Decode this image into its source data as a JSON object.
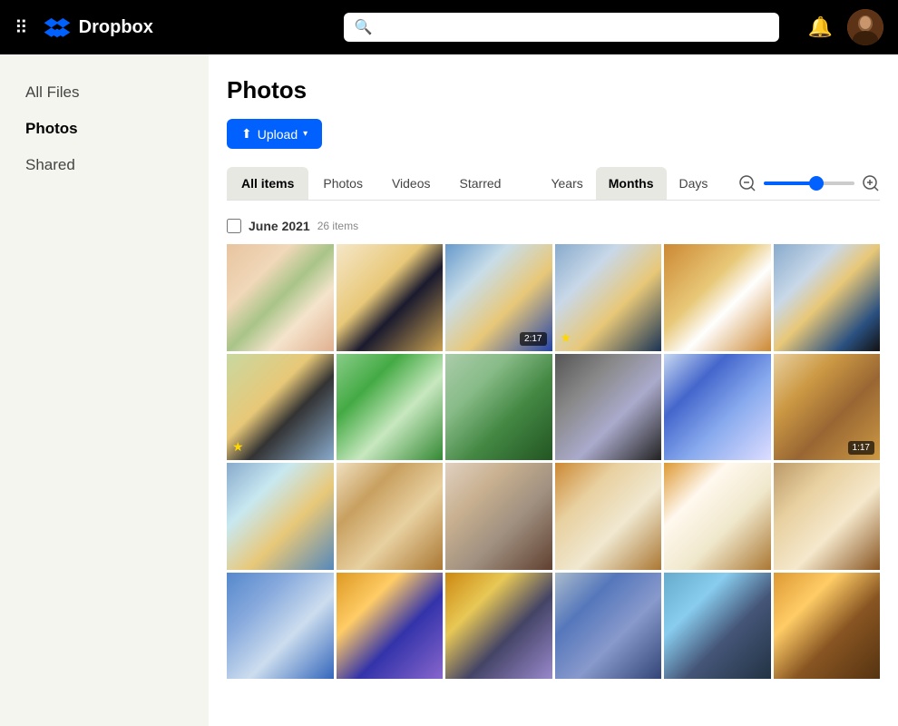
{
  "topbar": {
    "appName": "Dropbox",
    "search": {
      "placeholder": ""
    }
  },
  "sidebar": {
    "items": [
      {
        "id": "all-files",
        "label": "All Files",
        "active": false
      },
      {
        "id": "photos",
        "label": "Photos",
        "active": true
      },
      {
        "id": "shared",
        "label": "Shared",
        "active": false
      }
    ]
  },
  "main": {
    "title": "Photos",
    "uploadButton": "Upload",
    "filterTabs": [
      {
        "id": "all-items",
        "label": "All items",
        "active": true
      },
      {
        "id": "photos",
        "label": "Photos",
        "active": false
      },
      {
        "id": "videos",
        "label": "Videos",
        "active": false
      },
      {
        "id": "starred",
        "label": "Starred",
        "active": false
      }
    ],
    "timeTabs": [
      {
        "id": "years",
        "label": "Years",
        "active": false
      },
      {
        "id": "months",
        "label": "Months",
        "active": true
      },
      {
        "id": "days",
        "label": "Days",
        "active": false
      }
    ],
    "zoom": {
      "minusLabel": "−",
      "plusLabel": "+",
      "value": 60
    },
    "sections": [
      {
        "id": "june-2021",
        "title": "June 2021",
        "count": "26 items",
        "photos": [
          {
            "id": 1,
            "colorClass": "p1",
            "badge": null,
            "star": false
          },
          {
            "id": 2,
            "colorClass": "p2",
            "badge": null,
            "star": false
          },
          {
            "id": 3,
            "colorClass": "p3",
            "badge": "2:17",
            "star": false
          },
          {
            "id": 4,
            "colorClass": "p4",
            "badge": null,
            "star": true
          },
          {
            "id": 5,
            "colorClass": "p5",
            "badge": null,
            "star": false
          },
          {
            "id": 6,
            "colorClass": "p6",
            "badge": null,
            "star": false
          },
          {
            "id": 7,
            "colorClass": "p7",
            "badge": null,
            "star": true
          },
          {
            "id": 8,
            "colorClass": "p8",
            "badge": null,
            "star": false
          },
          {
            "id": 9,
            "colorClass": "p9",
            "badge": null,
            "star": false
          },
          {
            "id": 10,
            "colorClass": "p10",
            "badge": null,
            "star": false
          },
          {
            "id": 11,
            "colorClass": "p11",
            "badge": null,
            "star": false
          },
          {
            "id": 12,
            "colorClass": "p12",
            "badge": "1:17",
            "star": false
          },
          {
            "id": 13,
            "colorClass": "p13",
            "badge": null,
            "star": false
          },
          {
            "id": 14,
            "colorClass": "p14",
            "badge": null,
            "star": false
          },
          {
            "id": 15,
            "colorClass": "p15",
            "badge": null,
            "star": false
          },
          {
            "id": 16,
            "colorClass": "p16",
            "badge": null,
            "star": false
          },
          {
            "id": 17,
            "colorClass": "p17",
            "badge": null,
            "star": false
          },
          {
            "id": 18,
            "colorClass": "p18",
            "badge": null,
            "star": false
          },
          {
            "id": 19,
            "colorClass": "p19",
            "badge": null,
            "star": false
          },
          {
            "id": 20,
            "colorClass": "p20",
            "badge": null,
            "star": false
          },
          {
            "id": 21,
            "colorClass": "p21",
            "badge": null,
            "star": false
          },
          {
            "id": 22,
            "colorClass": "p22",
            "badge": null,
            "star": false
          },
          {
            "id": 23,
            "colorClass": "p23",
            "badge": null,
            "star": false
          },
          {
            "id": 24,
            "colorClass": "p24",
            "badge": null,
            "star": false
          }
        ]
      }
    ]
  }
}
